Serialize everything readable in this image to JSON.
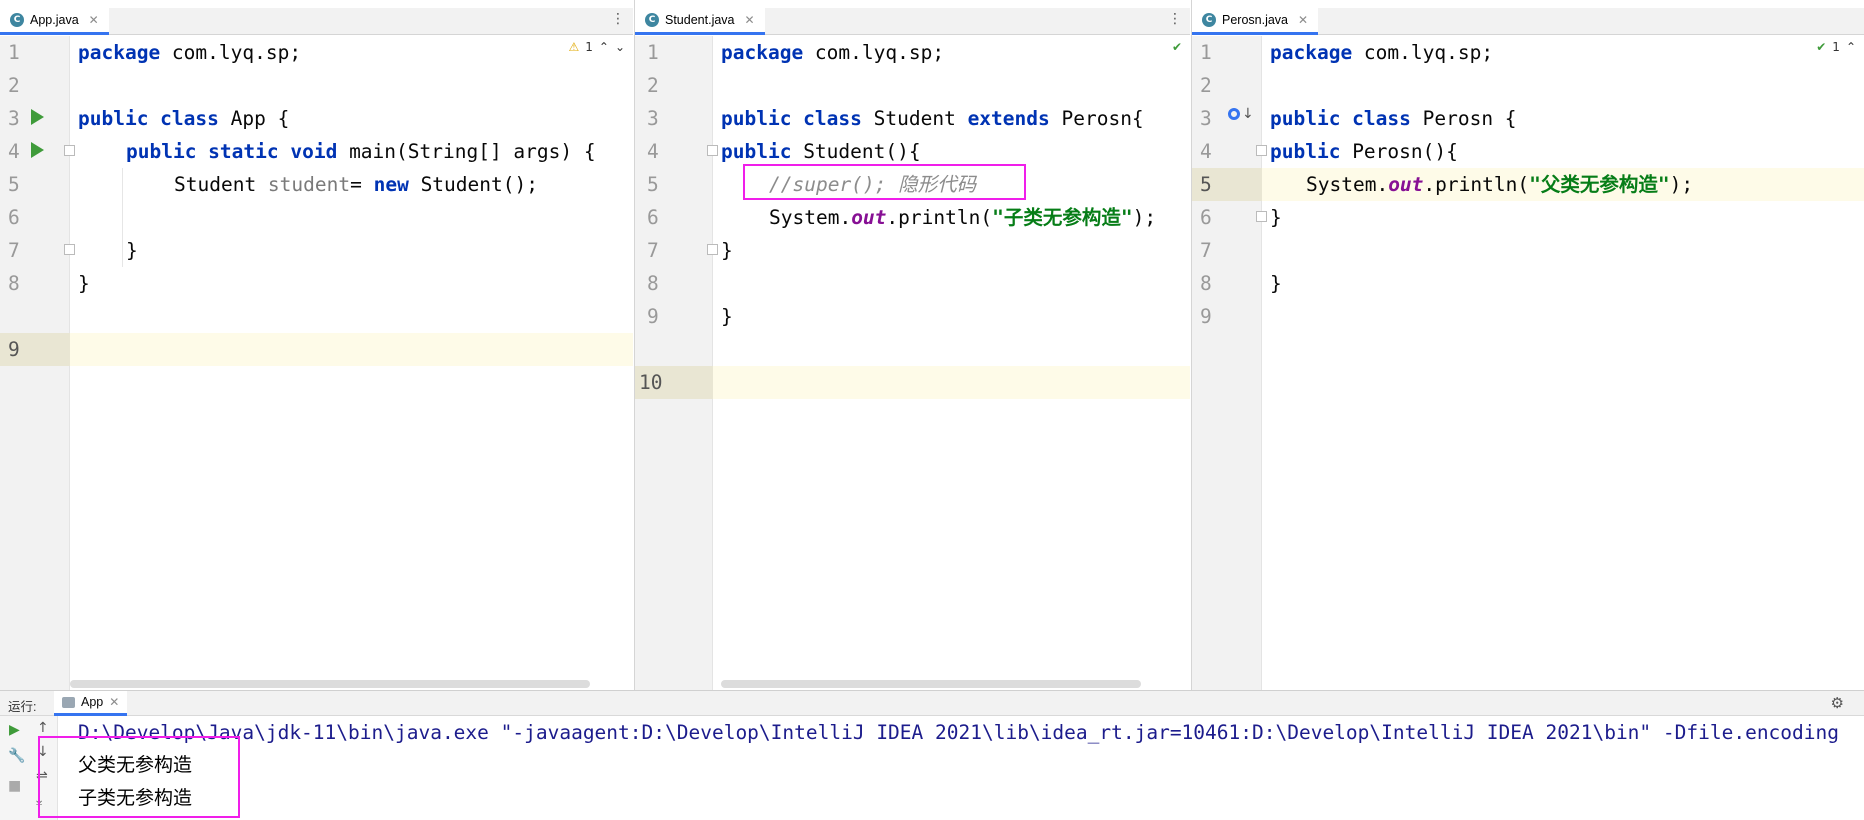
{
  "panes": [
    {
      "tab": {
        "icon_letter": "C",
        "name": "App.java"
      },
      "inspection": {
        "icon": "warning-icon",
        "count": "1"
      },
      "lines": [
        "1",
        "2",
        "3",
        "4",
        "5",
        "6",
        "7",
        "8",
        "9"
      ],
      "code": {
        "l1_kw": "package",
        "l1_rest": " com.lyq.sp;",
        "l3_kw": "public class",
        "l3_rest": " App {",
        "l4_kw": "public static void",
        "l4_rest": " main(String[] args) {",
        "l5_a": "Student ",
        "l5_var": "student",
        "l5_b": "= ",
        "l5_kw": "new",
        "l5_c": " Student();",
        "l7": "}",
        "l8": "}"
      }
    },
    {
      "tab": {
        "icon_letter": "C",
        "name": "Student.java"
      },
      "inspection": {
        "icon": "check-icon",
        "count": ""
      },
      "lines": [
        "1",
        "2",
        "3",
        "4",
        "5",
        "6",
        "7",
        "8",
        "9",
        "10"
      ],
      "code": {
        "l1_kw": "package",
        "l1_rest": " com.lyq.sp;",
        "l3_kw": "public class",
        "l3_mid": " Student ",
        "l3_kw2": "extends",
        "l3_rest": " Perosn{",
        "l4_kw": "public",
        "l4_rest": " Student(){",
        "l5_comment": "//super(); 隐形代码",
        "l6_a": "System.",
        "l6_field": "out",
        "l6_b": ".println(",
        "l6_str": "\"子类无参构造\"",
        "l6_c": ");",
        "l7": "}",
        "l9": "}"
      }
    },
    {
      "tab": {
        "icon_letter": "C",
        "name": "Perosn.java"
      },
      "inspection": {
        "icon": "check-icon",
        "count": "1"
      },
      "lines": [
        "1",
        "2",
        "3",
        "4",
        "5",
        "6",
        "7",
        "8",
        "9"
      ],
      "code": {
        "l1_kw": "package",
        "l1_rest": " com.lyq.sp;",
        "l3_kw": "public class",
        "l3_rest": " Perosn {",
        "l4_kw": "public",
        "l4_rest": " Perosn(){",
        "l5_a": "System.",
        "l5_field": "out",
        "l5_b": ".println(",
        "l5_str": "\"父类无参构造\"",
        "l5_c": ");",
        "l6": "}",
        "l8": "}"
      }
    }
  ],
  "run": {
    "label": "运行:",
    "tab_name": "App",
    "command": "D:\\Develop\\Java\\jdk-11\\bin\\java.exe \"-javaagent:D:\\Develop\\IntelliJ IDEA 2021\\lib\\idea_rt.jar=10461:D:\\Develop\\IntelliJ IDEA 2021\\bin\" -Dfile.encoding",
    "output": [
      "父类无参构造",
      "子类无参构造"
    ]
  },
  "colors": {
    "keyword": "#0033b3",
    "string": "#067d17",
    "field": "#871094",
    "comment": "#8c8c8c",
    "highlight_box": "#f01eea",
    "current_line": "#fefbe8"
  }
}
